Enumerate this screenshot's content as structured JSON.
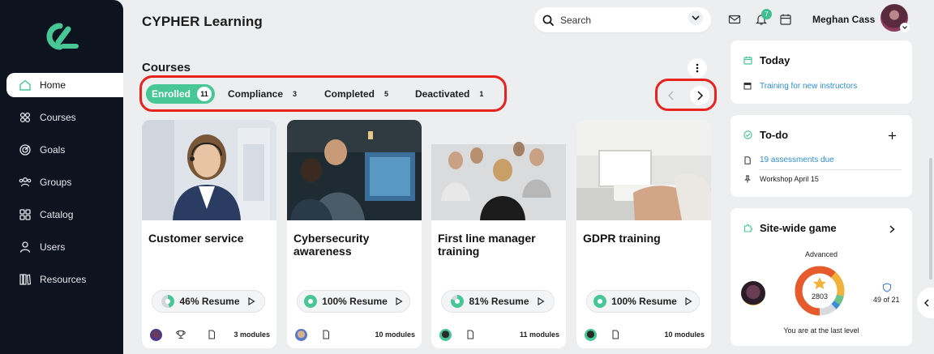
{
  "app": {
    "title": "CYPHER Learning"
  },
  "colors": {
    "accent": "#46c795",
    "sidebar": "#0d1420",
    "link": "#2d8fd0",
    "highlight_ring": "#e8221c"
  },
  "sidebar": {
    "items": [
      {
        "label": "Home",
        "icon": "home-icon",
        "active": true
      },
      {
        "label": "Courses",
        "icon": "courses-icon",
        "active": false
      },
      {
        "label": "Goals",
        "icon": "goals-icon",
        "active": false
      },
      {
        "label": "Groups",
        "icon": "groups-icon",
        "active": false
      },
      {
        "label": "Catalog",
        "icon": "catalog-icon",
        "active": false
      },
      {
        "label": "Users",
        "icon": "users-icon",
        "active": false
      },
      {
        "label": "Resources",
        "icon": "resources-icon",
        "active": false
      }
    ]
  },
  "header": {
    "search_placeholder": "Search",
    "notifications_count": "7",
    "user_name": "Meghan Cass"
  },
  "courses": {
    "title": "Courses",
    "tabs": [
      {
        "label": "Enrolled",
        "count": "11",
        "active": true
      },
      {
        "label": "Compliance",
        "count": "3",
        "active": false
      },
      {
        "label": "Completed",
        "count": "5",
        "active": false
      },
      {
        "label": "Deactivated",
        "count": "1",
        "active": false
      }
    ],
    "cards": [
      {
        "title": "Customer service",
        "progress": 46,
        "resume": "46% Resume",
        "modules": "3 modules",
        "has_trophy": true
      },
      {
        "title": "Cybersecurity awareness",
        "progress": 100,
        "resume": "100% Resume",
        "modules": "10 modules",
        "has_trophy": false
      },
      {
        "title": "First line manager training",
        "progress": 81,
        "resume": "81% Resume",
        "modules": "11 modules",
        "has_trophy": false
      },
      {
        "title": "GDPR training",
        "progress": 100,
        "resume": "100% Resume",
        "modules": "10 modules",
        "has_trophy": false
      }
    ]
  },
  "today": {
    "title": "Today",
    "items": [
      {
        "label": "Training for new instructors"
      }
    ]
  },
  "todo": {
    "title": "To-do",
    "items": [
      {
        "label": "19 assessments due",
        "link": true
      },
      {
        "label": "Workshop April 15",
        "link": false
      }
    ]
  },
  "game": {
    "title": "Site-wide game",
    "level": "Advanced",
    "score": "2803",
    "rank": "49 of 21",
    "footer": "You are at the last level"
  }
}
